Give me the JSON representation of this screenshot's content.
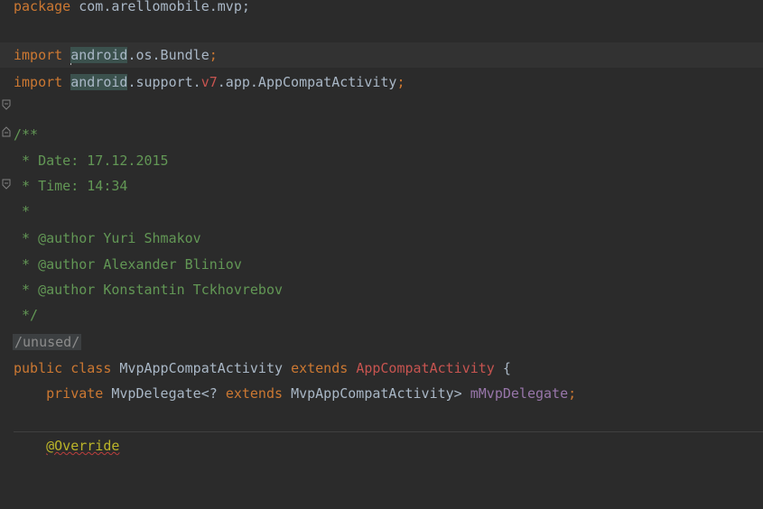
{
  "editor": {
    "lines": {
      "l0": {
        "kw": "package",
        "rest": " com.arellomobile.mvp;"
      },
      "l2": {
        "kw": "import",
        "pre": "android",
        "mid": ".os.Bundle",
        "semi": ";"
      },
      "l3": {
        "kw": "import",
        "pre": "android",
        "mid": ".support.",
        "v7": "v7",
        "tail": ".app.AppCompatActivity",
        "semi": ";"
      },
      "l5": "/**",
      "l6": " * Date: 17.12.2015",
      "l7": " * Time: 14:34",
      "l8": " *",
      "l9": " * @author Yuri Shmakov",
      "l10": " * @author Alexander Bliniov",
      "l11": " * @author Konstantin Tckhovrebov",
      "l12": " */",
      "l13": "/unused/",
      "l14": {
        "kw1": "public",
        "kw2": "class",
        "name": "MvpAppCompatActivity",
        "kw3": "extends",
        "sup": "AppCompatActivity",
        "brace": " {"
      },
      "l15": {
        "kw1": "private",
        "type": "MvpDelegate<?",
        "kw2": "extends",
        "type2": "MvpAppCompatActivity>",
        "field": "mMvpDelegate",
        "semi": ";"
      },
      "l17": "@Override"
    }
  }
}
